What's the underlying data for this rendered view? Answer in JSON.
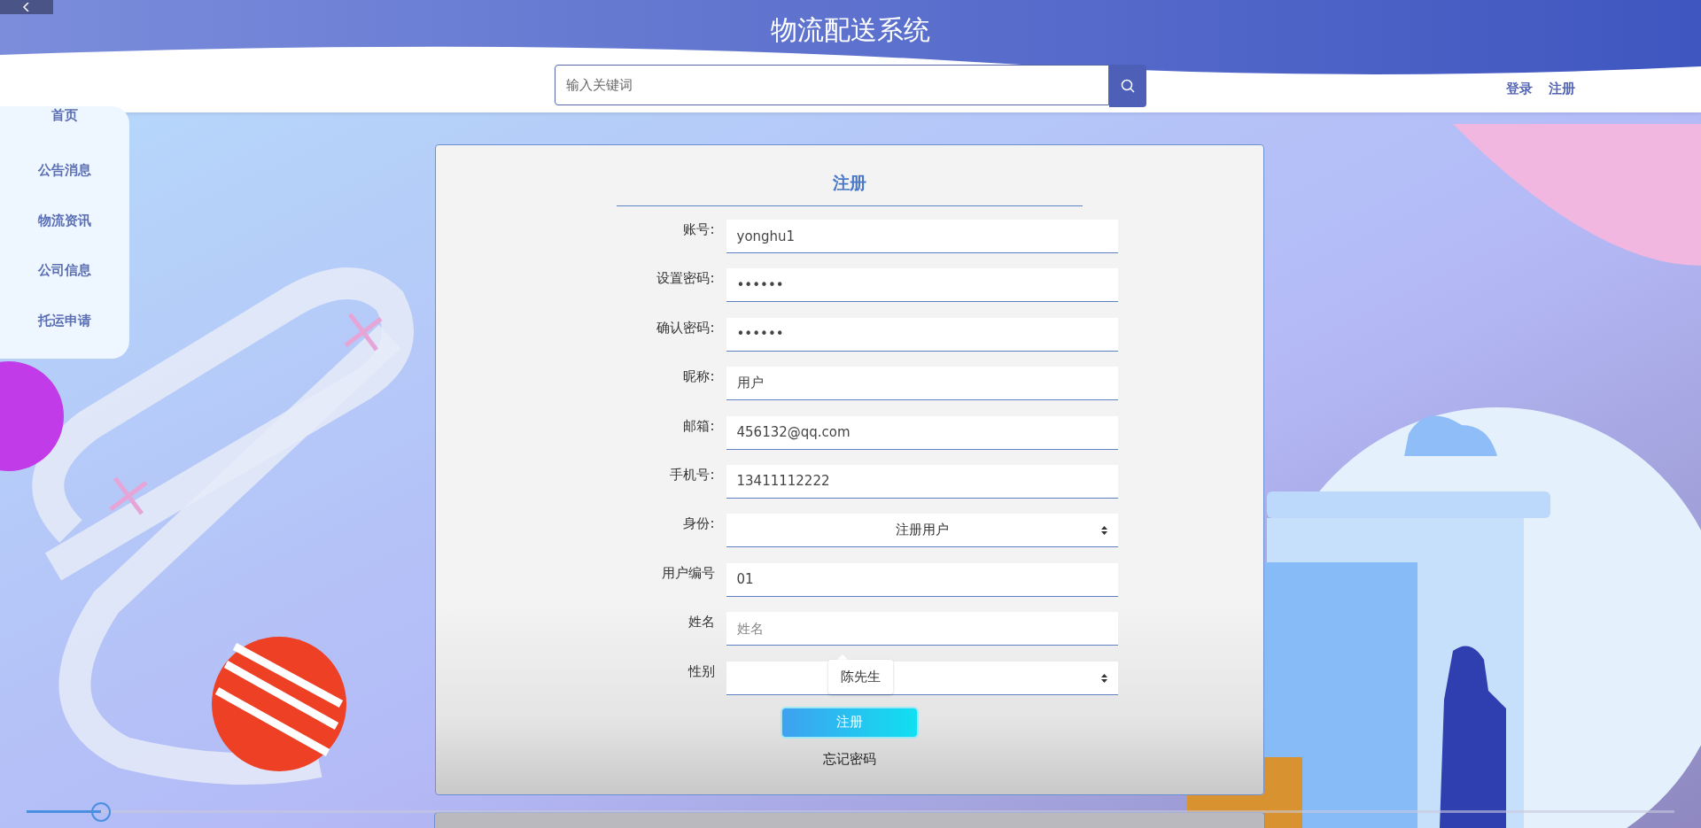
{
  "site_title": "物流配送系统",
  "search": {
    "placeholder": "输入关键词"
  },
  "auth_links": [
    "登录",
    "注册"
  ],
  "sidebar": {
    "items": [
      "首页",
      "公告消息",
      "物流资讯",
      "公司信息",
      "托运申请"
    ]
  },
  "form": {
    "title": "注册",
    "fields": [
      {
        "label": "账号:",
        "kind": "text",
        "value": "yonghu1"
      },
      {
        "label": "设置密码:",
        "kind": "text",
        "value": "••••••"
      },
      {
        "label": "确认密码:",
        "kind": "text",
        "value": "••••••"
      },
      {
        "label": "昵称:",
        "kind": "text",
        "value": "用户"
      },
      {
        "label": "邮箱:",
        "kind": "text",
        "value": "456132@qq.com"
      },
      {
        "label": "手机号:",
        "kind": "text",
        "value": "13411112222"
      },
      {
        "label": "身份:",
        "kind": "select",
        "value": "注册用户"
      },
      {
        "label": "用户编号",
        "kind": "text",
        "value": "01"
      },
      {
        "label": "姓名",
        "kind": "text",
        "placeholder": "姓名",
        "suggestion": "陈先生"
      },
      {
        "label": "性别",
        "kind": "select"
      }
    ],
    "submit": "注册",
    "forgot_link": "忘记密码"
  },
  "video_player": {
    "level": 0.045
  }
}
